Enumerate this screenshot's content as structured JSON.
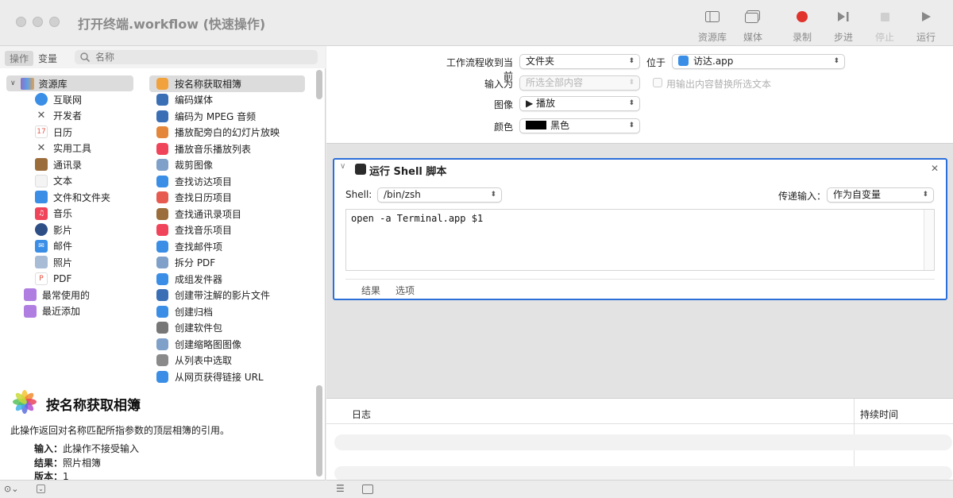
{
  "window": {
    "title": "打开终端.workflow (快速操作)"
  },
  "toolbar": {
    "library_label": "资源库",
    "media_label": "媒体",
    "record_label": "录制",
    "step_label": "步进",
    "stop_label": "停止",
    "run_label": "运行",
    "record_color": "#e0332c"
  },
  "left": {
    "tab_actions": "操作",
    "tab_variables": "变量",
    "search_placeholder": "名称",
    "library_label": "资源库",
    "categories": [
      {
        "label": "互联网",
        "icon": "globe-icon"
      },
      {
        "label": "开发者",
        "icon": "tools-icon"
      },
      {
        "label": "日历",
        "icon": "calendar-icon"
      },
      {
        "label": "实用工具",
        "icon": "utility-icon"
      },
      {
        "label": "通讯录",
        "icon": "contacts-icon"
      },
      {
        "label": "文本",
        "icon": "text-icon"
      },
      {
        "label": "文件和文件夹",
        "icon": "finder-icon"
      },
      {
        "label": "音乐",
        "icon": "music-icon"
      },
      {
        "label": "影片",
        "icon": "movie-icon"
      },
      {
        "label": "邮件",
        "icon": "mail-icon"
      },
      {
        "label": "照片",
        "icon": "photos-icon"
      },
      {
        "label": "PDF",
        "icon": "pdf-icon"
      }
    ],
    "smart_folders": [
      {
        "label": "最常使用的",
        "icon": "folder-icon"
      },
      {
        "label": "最近添加",
        "icon": "folder-icon"
      }
    ],
    "actions": [
      {
        "label": "按名称获取相簿",
        "icon": "photos-icon",
        "color": "#f2a23c"
      },
      {
        "label": "编码媒体",
        "icon": "quicktime-icon",
        "color": "#3a6fb6"
      },
      {
        "label": "编码为 MPEG 音频",
        "icon": "quicktime-icon",
        "color": "#3a6fb6"
      },
      {
        "label": "播放配旁白的幻灯片放映",
        "icon": "photos-icon",
        "color": "#e4873a"
      },
      {
        "label": "播放音乐播放列表",
        "icon": "music-icon",
        "color": "#f0445a"
      },
      {
        "label": "裁剪图像",
        "icon": "preview-icon",
        "color": "#7fa0c8"
      },
      {
        "label": "查找访达项目",
        "icon": "finder-icon",
        "color": "#3a8ee6"
      },
      {
        "label": "查找日历项目",
        "icon": "calendar-icon",
        "color": "#e65a4f"
      },
      {
        "label": "查找通讯录项目",
        "icon": "contacts-icon",
        "color": "#9b6d3a"
      },
      {
        "label": "查找音乐项目",
        "icon": "music-icon",
        "color": "#f0445a"
      },
      {
        "label": "查找邮件项",
        "icon": "mail-icon",
        "color": "#3a8ee6"
      },
      {
        "label": "拆分 PDF",
        "icon": "preview-icon",
        "color": "#7fa0c8"
      },
      {
        "label": "成组发件器",
        "icon": "mail-icon",
        "color": "#3a8ee6"
      },
      {
        "label": "创建带注解的影片文件",
        "icon": "quicktime-icon",
        "color": "#3a6fb6"
      },
      {
        "label": "创建归档",
        "icon": "finder-icon",
        "color": "#3a8ee6"
      },
      {
        "label": "创建软件包",
        "icon": "tools-icon",
        "color": "#777777"
      },
      {
        "label": "创建缩略图图像",
        "icon": "preview-icon",
        "color": "#7fa0c8"
      },
      {
        "label": "从列表中选取",
        "icon": "automator-icon",
        "color": "#8a8a8a"
      },
      {
        "label": "从网页获得链接 URL",
        "icon": "safari-icon",
        "color": "#3a8ee6"
      }
    ],
    "description": {
      "title": "按名称获取相簿",
      "text": "此操作返回对名称匹配所指参数的顶层相簿的引用。",
      "input_key": "输入：",
      "input_value": "此操作不接受输入",
      "result_key": "结果：",
      "result_value": "照片相簿",
      "version_key": "版本：",
      "version_value": "1"
    }
  },
  "workflow": {
    "receives_label": "工作流程收到当前",
    "receives_value": "文件夹",
    "in_label": "位于",
    "in_value": "访达.app",
    "input_is_label": "输入为",
    "input_is_value": "所选全部内容",
    "replace_label": "用输出内容替换所选文本",
    "image_label": "图像",
    "image_value": "▶ 播放",
    "color_label": "颜色",
    "color_value": "黑色",
    "color_swatch": "#000000"
  },
  "action": {
    "title": "运行 Shell 脚本",
    "shell_label": "Shell:",
    "shell_value": "/bin/zsh",
    "pass_label": "传递输入：",
    "pass_value": "作为自变量",
    "script": "open -a Terminal.app $1",
    "tab_results": "结果",
    "tab_options": "选项"
  },
  "log": {
    "col_log": "日志",
    "col_duration": "持续时间"
  }
}
